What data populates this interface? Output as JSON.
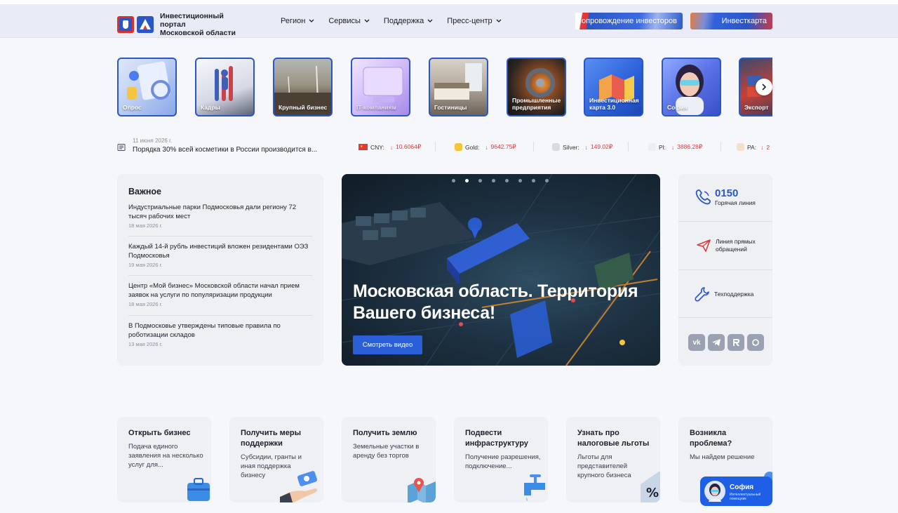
{
  "header": {
    "logo_text_line1": "Инвестиционный портал",
    "logo_text_line2": "Московской области",
    "nav": [
      {
        "label": "Регион"
      },
      {
        "label": "Сервисы"
      },
      {
        "label": "Поддержка"
      },
      {
        "label": "Пресс-центр"
      }
    ],
    "btn_investors": "Сопровождение инвесторов",
    "btn_invest_map": "Инвесткарта"
  },
  "tiles": [
    {
      "label": "Опрос",
      "icon": "survey-illustration"
    },
    {
      "label": "Кадры",
      "icon": "staff-illustration"
    },
    {
      "label": "Крупный бизнес",
      "icon": "windmill-photo"
    },
    {
      "label": "IT-компаниям",
      "icon": "computer-illustration"
    },
    {
      "label": "Гостиницы",
      "icon": "hotel-photo"
    },
    {
      "label": "Промышленные предприятия",
      "icon": "factory-photo"
    },
    {
      "label": "Инвестиционная карта 3.0",
      "icon": "map-illustration"
    },
    {
      "label": "София",
      "icon": "assistant-avatar"
    },
    {
      "label": "Экспорт",
      "icon": "export-photo"
    }
  ],
  "newsline": {
    "date": "11 июня 2026 г.",
    "text": "Порядка 30% всей косметики в России производится в..."
  },
  "tickers": [
    {
      "name": "CNY:",
      "value": "10.6064₽",
      "icon": "china-flag-icon",
      "color": "#e03b2e"
    },
    {
      "name": "Gold:",
      "value": "9642.75₽",
      "icon": "gold-coin-icon",
      "color": "#f2c53d"
    },
    {
      "name": "Silver:",
      "value": "149.02₽",
      "icon": "silver-coin-icon",
      "color": "#d8dbe2"
    },
    {
      "name": "Pl:",
      "value": "3886.28₽",
      "icon": "platinum-coin-icon",
      "color": "#eceef2"
    },
    {
      "name": "PA:",
      "value": "2",
      "icon": "palladium-coin-icon",
      "color": "#f3e1cf"
    }
  ],
  "important": {
    "title": "Важное",
    "items": [
      {
        "text": "Индустриальные парки Подмосковья дали региону 72 тысяч рабочих мест",
        "date": "18 мая 2026 г."
      },
      {
        "text": "Каждый 14-й рубль инвестиций вложен резидентами ОЭЗ Подмосковья",
        "date": "19 мая 2026 г."
      },
      {
        "text": "Центр «Мой бизнес» Московской области начал прием заявок на услуги по популяризации продукции",
        "date": "18 мая 2026 г."
      },
      {
        "text": "В Подмосковье утверждены типовые правила по роботизации складов",
        "date": "13 мая 2026 г."
      }
    ]
  },
  "hero": {
    "title": "Московская область. Территория Вашего бизнеса!",
    "button": "Смотреть видео",
    "active_slide": 2,
    "slides": 8
  },
  "contacts": {
    "hotline_number": "0150",
    "hotline_label": "Горячая линия",
    "direct_line": "Линия прямых обращений",
    "tech_support": "Техподдержка",
    "social": [
      "vk-icon",
      "telegram-icon",
      "rutube-icon",
      "max-icon"
    ]
  },
  "cards": [
    {
      "title": "Открыть бизнес",
      "text": "Подача единого заявления на несколько услуг для...",
      "icon": "briefcase-icon"
    },
    {
      "title": "Получить меры поддержки",
      "text": "Субсидии, гранты и иная поддержка бизнесу",
      "icon": "money-hand-icon"
    },
    {
      "title": "Получить землю",
      "text": "Земельные участки в аренду без торгов",
      "icon": "map-pin-icon"
    },
    {
      "title": "Подвести инфраструктуру",
      "text": "Получение разрешения, подключение...",
      "icon": "water-tap-icon"
    },
    {
      "title": "Узнать про налоговые льготы",
      "text": "Льготы для представителей крупного бизнеса",
      "icon": "percent-icon"
    },
    {
      "title": "Возникла проблема?",
      "text": "Мы найдем решение",
      "icon": "chat-icon"
    }
  ],
  "sofia": {
    "name": "София",
    "subtitle": "Интеллектуальный помощник"
  }
}
